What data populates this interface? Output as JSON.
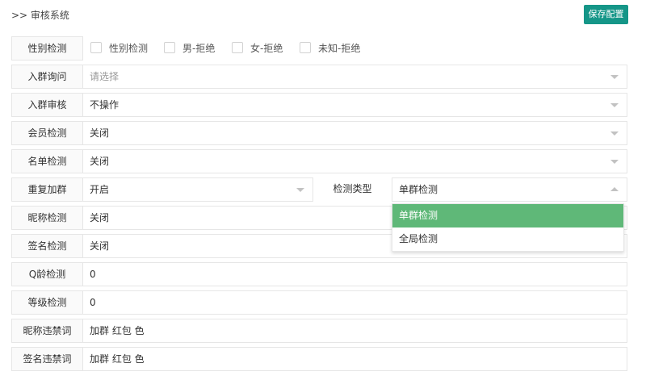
{
  "header": {
    "title": ">> 审核系统",
    "save_label": "保存配置"
  },
  "rows": {
    "gender": {
      "label": "性别检测",
      "options": [
        "性别检测",
        "男-拒绝",
        "女-拒绝",
        "未知-拒绝"
      ]
    },
    "join_ask": {
      "label": "入群询问",
      "placeholder": "请选择"
    },
    "join_review": {
      "label": "入群审核",
      "value": "不操作"
    },
    "member": {
      "label": "会员检测",
      "value": "关闭"
    },
    "list": {
      "label": "名单检测",
      "value": "关闭"
    },
    "dup_join": {
      "label": "重复加群",
      "value": "开启",
      "type_label": "检测类型",
      "type_value": "单群检测",
      "type_options": [
        "单群检测",
        "全局检测"
      ]
    },
    "nickname": {
      "label": "昵称检测",
      "value": "关闭"
    },
    "signature": {
      "label": "签名检测",
      "value": "关闭"
    },
    "q_age": {
      "label": "Q龄检测",
      "value": "0"
    },
    "level": {
      "label": "等级检测",
      "value": "0"
    },
    "nick_ban": {
      "label": "昵称违禁词",
      "value": "加群 红包 色"
    },
    "sig_ban": {
      "label": "签名违禁词",
      "value": "加群 红包 色"
    }
  },
  "icons": {
    "dropdown": "chevron-down-icon",
    "dropdown_open": "chevron-up-icon",
    "checkbox": "checkbox-icon"
  },
  "colors": {
    "primary": "#159688",
    "selected_option": "#5fb878"
  }
}
